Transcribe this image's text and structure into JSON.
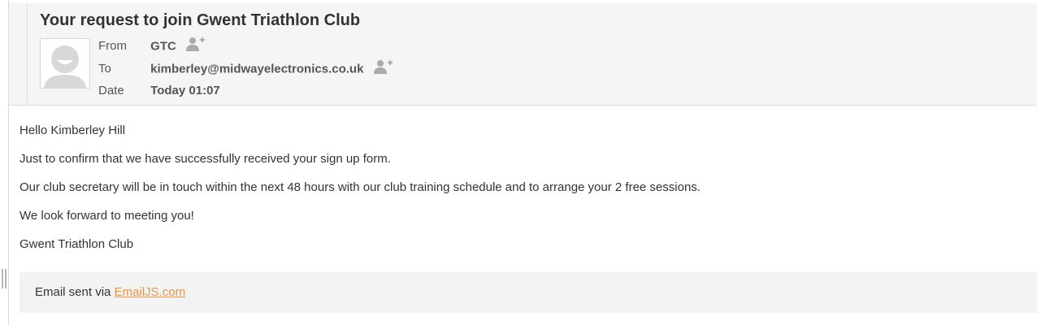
{
  "message": {
    "subject": "Your request to join Gwent Triathlon Club",
    "from_label": "From",
    "from_value": "GTC",
    "to_label": "To",
    "to_value": "kimberley@midwayelectronics.co.uk",
    "date_label": "Date",
    "date_value": "Today 01:07",
    "icons": {
      "avatar": "default-user-avatar-icon",
      "add_contact": "add-contact-icon"
    }
  },
  "body": {
    "lines": [
      "Hello Kimberley Hill",
      "Just to confirm that we have successfully received your sign up form.",
      "Our club secretary will be in touch within the next 48 hours with our club training schedule and to arrange your 2 free sessions.",
      "We look forward to meeting you!",
      "Gwent Triathlon Club"
    ]
  },
  "footer": {
    "prefix": "Email sent via",
    "link_text": "EmailJS.com"
  },
  "colors": {
    "link": "#e8964a",
    "header_bg": "#f5f5f5",
    "footer_bg": "#f3f3f3"
  }
}
